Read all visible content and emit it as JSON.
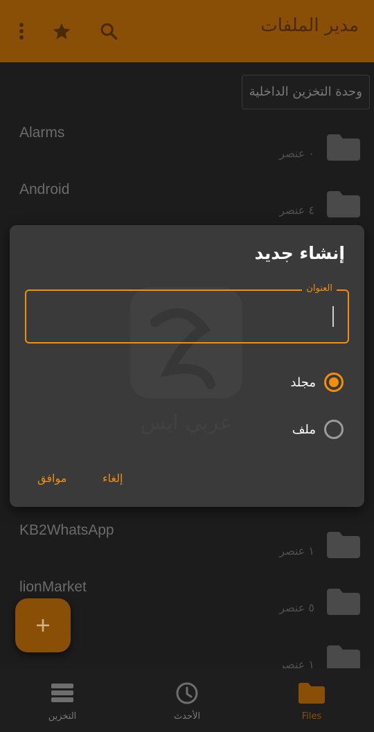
{
  "appbar": {
    "title": "مدير الملفات",
    "more_icon": "more-vert-icon",
    "star_icon": "star-icon",
    "search_icon": "search-icon"
  },
  "breadcrumb": {
    "label": "وحدة التخزين الداخلية"
  },
  "files": [
    {
      "name": "Alarms",
      "count": "٠ عنصر"
    },
    {
      "name": "Android",
      "count": "٤ عنصر"
    },
    {
      "name": "KB2WhatsApp",
      "count": "١ عنصر"
    },
    {
      "name": "lionMarket",
      "count": "٥ عنصر"
    },
    {
      "name": "",
      "count": "١ عنصر"
    }
  ],
  "dialog": {
    "title": "إنشاء جديد",
    "field_label": "العنوان",
    "field_value": "",
    "options": [
      {
        "label": "مجلد",
        "selected": true
      },
      {
        "label": "ملف",
        "selected": false
      }
    ],
    "ok_label": "موافق",
    "cancel_label": "إلغاء",
    "watermark_brand": "عربي ايس"
  },
  "fab": {
    "icon": "plus-icon"
  },
  "bottomnav": {
    "items": [
      {
        "label": "التخزين",
        "icon": "storage-icon",
        "active": false
      },
      {
        "label": "الأحدث",
        "icon": "clock-icon",
        "active": false
      },
      {
        "label": "Files",
        "icon": "folder-icon",
        "active": true
      }
    ]
  },
  "colors": {
    "accent": "#f18f0c",
    "appbar": "#8a4f06",
    "background": "#1c1c1c",
    "dialog": "#3a3a3a"
  }
}
